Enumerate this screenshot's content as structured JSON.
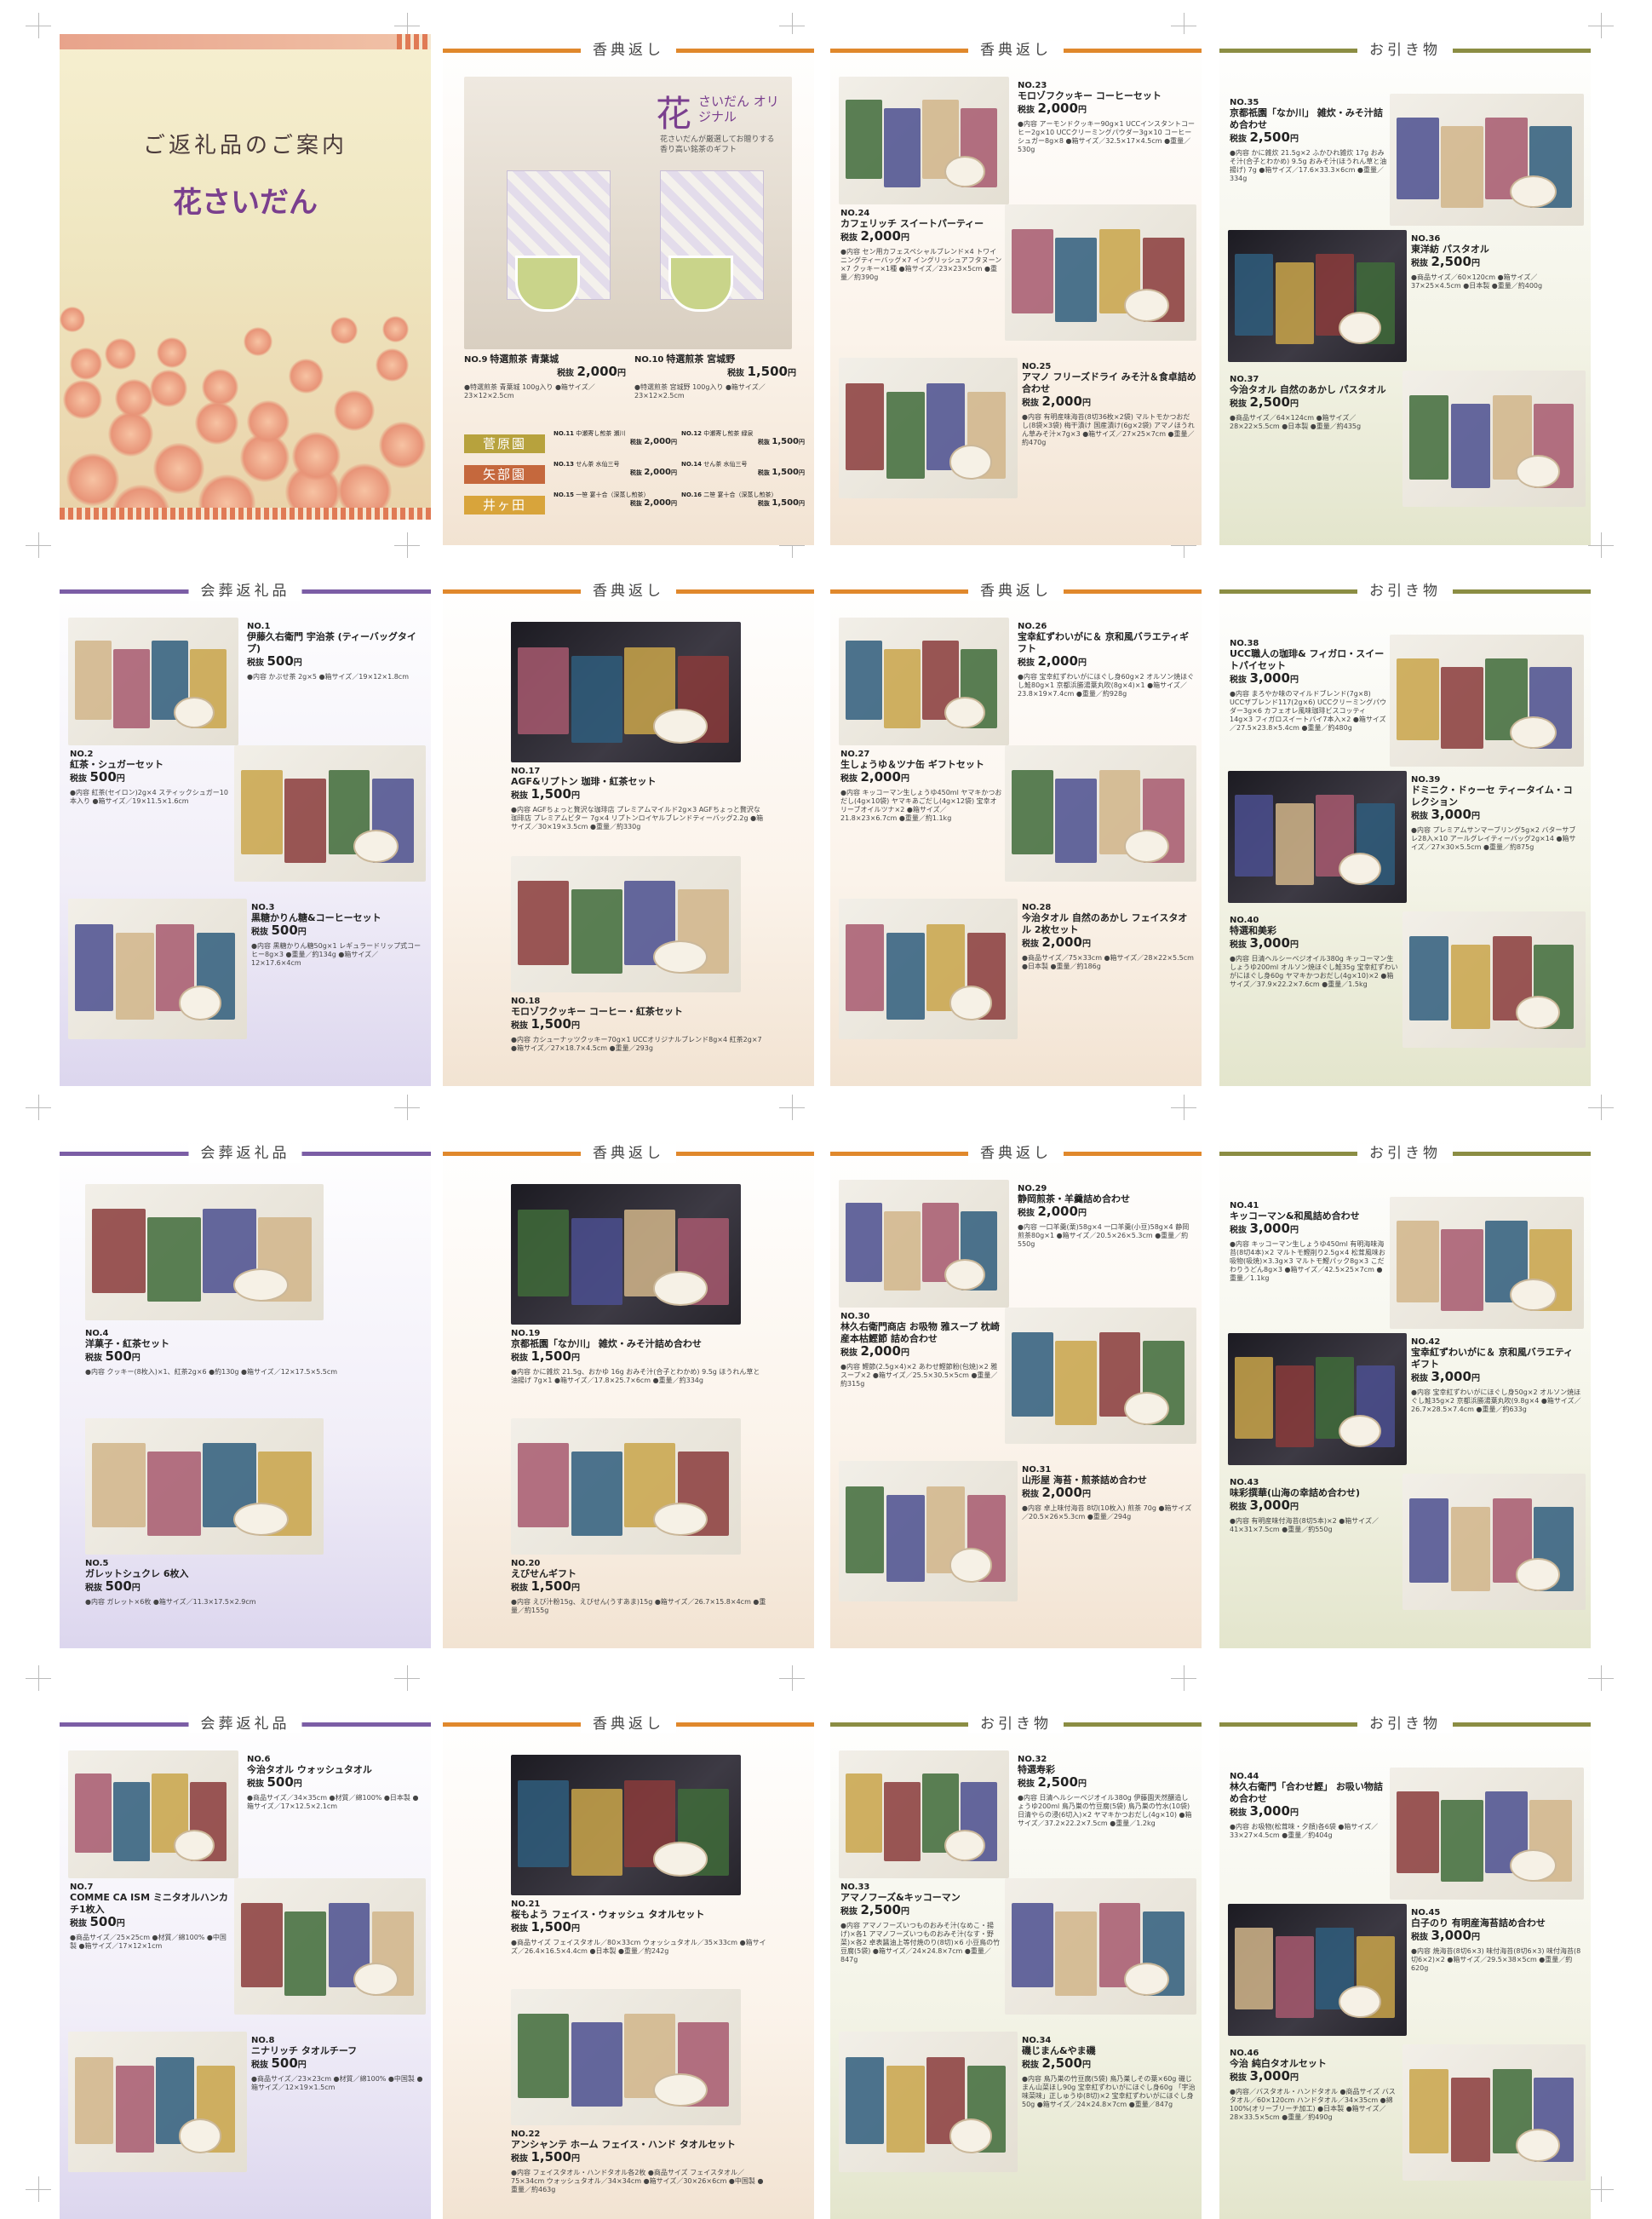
{
  "pages": [
    {
      "header": "",
      "kind": "cover",
      "title": "ご返礼品のご案内",
      "logo": "花さいだん",
      "items": []
    },
    {
      "header": "香典返し",
      "kind": "tea",
      "brand_big": "花",
      "brand_title": "さいだん オリジナル",
      "brand_sub": "花さいだんが厳選してお贈りする 香り高い銘茶のギフト",
      "items": [
        {
          "no": "NO.9",
          "name": "特選煎茶 青葉城",
          "price": "2,000",
          "desc": "●特選煎茶 青葉城 100g入り ●箱サイズ／23×12×2.5cm"
        },
        {
          "no": "NO.10",
          "name": "特選煎茶 宮城野",
          "price": "1,500",
          "desc": "●特選煎茶 宮城野 100g入り ●箱サイズ／23×12×2.5cm"
        }
      ],
      "brands": [
        "菅原園",
        "矢部園",
        "井ヶ田"
      ],
      "small": [
        {
          "no": "NO.11",
          "name": "中瀬寄し煎茶 瀬川",
          "price": "2,000"
        },
        {
          "no": "NO.12",
          "name": "中瀬寄し煎茶 緑泉",
          "price": "1,500"
        },
        {
          "no": "NO.13",
          "name": "せん茶 水仙三号",
          "price": "2,000"
        },
        {
          "no": "NO.14",
          "name": "せん茶 水仙三号",
          "price": "1,500"
        },
        {
          "no": "NO.15",
          "name": "一笹 宴十合（深蒸し煎茶）",
          "price": "2,000"
        },
        {
          "no": "NO.16",
          "name": "二笹 宴十合（深蒸し煎茶）",
          "price": "1,500"
        }
      ]
    },
    {
      "header": "香典返し",
      "items": [
        {
          "no": "NO.23",
          "name": "モロゾフクッキー コーヒーセット",
          "price": "2,000",
          "desc": "●内容 アーモンドクッキー90g×1 UCCインスタントコーヒー2g×10 UCCクリーミングパウダー3g×10 コーヒーシュガー8g×8 ●箱サイズ／32.5×17×4.5cm ●重量／530g"
        },
        {
          "no": "NO.24",
          "name": "カフェリッチ スイートパーティー",
          "price": "2,000",
          "desc": "●内容 セン用カフェスペシャルブレンド×4 トワイニングティーバッグ×7 イングリッシュアフタヌーン×7 クッキー×1種 ●箱サイズ／23×23×5cm ●重量／約390g"
        },
        {
          "no": "NO.25",
          "name": "アマノ フリーズドライ みそ汁＆食卓詰め合わせ",
          "price": "2,000",
          "desc": "●内容 有明産味海苔(8切36枚×2袋) マルトモかつおだし(8袋×3袋) 梅干漬け 国産漬け(6g×2袋) アマノほうれん草みそ汁×7g×3 ●箱サイズ／27×25×7cm ●重量／約470g"
        }
      ]
    },
    {
      "header": "お引き物",
      "items": [
        {
          "no": "NO.35",
          "name": "京都祇園「なか川」 雑炊・みそ汁詰め合わせ",
          "price": "2,500",
          "desc": "●内容 かに雑炊 21.5g×2 ふかひれ雑炊 17g おみそ汁(合子とわかめ) 9.5g おみそ汁(ほうれん草と油揚げ) 7g ●箱サイズ／17.6×33.3×6cm ●重量／334g"
        },
        {
          "no": "NO.36",
          "name": "東洋紡 パスタオル",
          "price": "2,500",
          "desc": "●商品サイズ／60×120cm ●箱サイズ／37×25×4.5cm ●日本製 ●重量／約400g"
        },
        {
          "no": "NO.37",
          "name": "今治タオル 自然のあかし パスタオル",
          "price": "2,500",
          "desc": "●商品サイズ／64×124cm ●箱サイズ／28×22×5.5cm ●日本製 ●重量／約435g"
        }
      ]
    },
    {
      "header": "会葬返礼品",
      "items": [
        {
          "no": "NO.1",
          "name": "伊藤久右衛門 宇治茶 (ティーバッグタイプ)",
          "price": "500",
          "desc": "●内容 かぶせ茶 2g×5 ●箱サイズ／19×12×1.8cm"
        },
        {
          "no": "NO.2",
          "name": "紅茶・シュガーセット",
          "price": "500",
          "desc": "●内容 紅茶(セイロン)2g×4 スティックシュガー10本入り ●箱サイズ／19×11.5×1.6cm"
        },
        {
          "no": "NO.3",
          "name": "黒糖かりん糖&コーヒーセット",
          "price": "500",
          "desc": "●内容 黒糖かりん糖50g×1 レギュラードリップ式コーヒー8g×3 ●重量／約134g ●箱サイズ／12×17.6×4cm"
        }
      ]
    },
    {
      "header": "香典返し",
      "items": [
        {
          "no": "NO.17",
          "name": "AGF&リプトン 珈琲・紅茶セット",
          "price": "1,500",
          "desc": "●内容 AGFちょっと贅沢な珈琲店 プレミアムマイルド2g×3 AGFちょっと贅沢な珈琲店 プレミアムビター 7g×4 リプトンロイヤルブレンドティーバッグ2.2g ●箱サイズ／30×19×3.5cm ●重量／約330g"
        },
        {
          "no": "NO.18",
          "name": "モロゾフクッキー コーヒー・紅茶セット",
          "price": "1,500",
          "desc": "●内容 カシューナッツクッキー70g×1 UCCオリジナルブレンド8g×4 紅茶2g×7 ●箱サイズ／27×18.7×4.5cm ●重量／293g"
        }
      ]
    },
    {
      "header": "香典返し",
      "items": [
        {
          "no": "NO.26",
          "name": "宝幸紅ずわいがに＆ 京和風バラエティギフト",
          "price": "2,000",
          "desc": "●内容 宝幸紅ずわいがにほぐし身60g×2 オルソン焼ほぐし鮭80g×1 京都浜勝湯葉丸吹(8g×4)×1 ●箱サイズ／23.8×19×7.4cm ●重量／約928g"
        },
        {
          "no": "NO.27",
          "name": "生しょうゆ＆ツナ缶 ギフトセット",
          "price": "2,000",
          "desc": "●内容 キッコーマン生しょうゆ450ml ヤマキかつおだし(4g×10袋) ヤマキあごだし(4g×12袋) 宝幸オリーブオイルツナ×2 ●箱サイズ／21.8×23×6.7cm ●重量／約1.1kg"
        },
        {
          "no": "NO.28",
          "name": "今治タオル 自然のあかし フェイスタオル 2枚セット",
          "price": "2,000",
          "desc": "●商品サイズ／75×33cm ●箱サイズ／28×22×5.5cm ●日本製 ●重量／約186g"
        }
      ]
    },
    {
      "header": "お引き物",
      "items": [
        {
          "no": "NO.38",
          "name": "UCC職人の珈琲& フィガロ・スイートパイセット",
          "price": "3,000",
          "desc": "●内容 まろやか味のマイルドブレンド(7g×8) UCCザブレンド117(2g×6) UCCクリーミングパウダー3g×6 カフェオレ風味珈琲ビスコッティ14g×3 フィガロスイートパイ7本入×2 ●箱サイズ／27.5×23.8×5.4cm ●重量／約480g"
        },
        {
          "no": "NO.39",
          "name": "ドミニク・ドゥーセ ティータイム・コレクション",
          "price": "3,000",
          "desc": "●内容 プレミアムサンマーブリング5g×2 バターサブレ28入×10 アールグレイティーバッグ2g×14 ●箱サイズ／27×30×5.5cm ●重量／約875g"
        },
        {
          "no": "NO.40",
          "name": "特選和美彩",
          "price": "3,000",
          "desc": "●内容 日清ヘルシーベジオイル380g キッコーマン生しょうゆ200ml オルソン焼ほぐし鮭35g 宝幸紅ずわいがにほぐし身60g ヤマキかつおだし(4g×10)×2 ●箱サイズ／37.9×22.2×7.6cm ●重量／1.5kg"
        }
      ]
    },
    {
      "header": "会葬返礼品",
      "items": [
        {
          "no": "NO.4",
          "name": "洋菓子・紅茶セット",
          "price": "500",
          "desc": "●内容 クッキー(8枚入)×1、紅茶2g×6 ●約130g ●箱サイズ／12×17.5×5.5cm"
        },
        {
          "no": "NO.5",
          "name": "ガレットシュクレ 6枚入",
          "price": "500",
          "desc": "●内容 ガレット×6枚 ●箱サイズ／11.3×17.5×2.9cm"
        }
      ]
    },
    {
      "header": "香典返し",
      "items": [
        {
          "no": "NO.19",
          "name": "京都祇園「なか川」 雑炊・みそ汁詰め合わせ",
          "price": "1,500",
          "desc": "●内容 かに雑炊 21.5g、おかゆ 16g おみそ汁(合子とわかめ) 9.5g ほうれん草と油揚げ 7g×1 ●箱サイズ／17.8×25.7×6cm ●重量／約334g"
        },
        {
          "no": "NO.20",
          "name": "えびせんギフト",
          "price": "1,500",
          "desc": "●内容 えび汁粉15g、えびせん(うすあま)15g ●箱サイズ／26.7×15.8×4cm ●重量／約155g"
        }
      ]
    },
    {
      "header": "香典返し",
      "items": [
        {
          "no": "NO.29",
          "name": "静岡煎茶・羊羹詰め合わせ",
          "price": "2,000",
          "desc": "●内容 一口羊羹(栗)58g×4 一口羊羹(小豆)58g×4 静岡煎茶80g×1 ●箱サイズ／20.5×26×5.3cm ●重量／約550g"
        },
        {
          "no": "NO.30",
          "name": "林久右衛門商店 お吸物 雅スープ 枕崎産本枯鰹節 詰め合わせ",
          "price": "2,000",
          "desc": "●内容 鰹節(2.5g×4)×2 あわせ鰹節粉(包焼)×2 雅スープ×2 ●箱サイズ／25.5×30.5×5cm ●重量／約315g"
        },
        {
          "no": "NO.31",
          "name": "山形屋 海苔・煎茶詰め合わせ",
          "price": "2,000",
          "desc": "●内容 卓上味付海苔 8切(10枚入) 煎茶 70g ●箱サイズ／20.5×26×5.3cm ●重量／294g"
        }
      ]
    },
    {
      "header": "お引き物",
      "items": [
        {
          "no": "NO.41",
          "name": "キッコーマン&和風詰め合わせ",
          "price": "3,000",
          "desc": "●内容 キッコーマン生しょうゆ450ml 有明海味海苔(8切4本)×2 マルトモ鰹削り2.5g×4 松茸風味お吸物(吸焼)×3.3g×3 マルトモ鰹パック8g×3 こだわりうどん8g×3 ●箱サイズ／42.5×25×7cm ●重量／1.1kg"
        },
        {
          "no": "NO.42",
          "name": "宝幸紅ずわいがに＆ 京和風バラエティギフト",
          "price": "3,000",
          "desc": "●内容 宝幸紅ずわいがにほぐし身50g×2 オルソン焼ほぐし鮭35g×2 京都浜勝湯葉丸吹(9.8g×4 ●箱サイズ／26.7×28.5×7.4cm ●重量／約633g"
        },
        {
          "no": "NO.43",
          "name": "味彩撰華(山海の幸詰め合わせ)",
          "price": "3,000",
          "desc": "●内容 有明産味付海苔(8切5本)×2 ●箱サイズ／41×31×7.5cm ●重量／約550g"
        }
      ]
    },
    {
      "header": "会葬返礼品",
      "items": [
        {
          "no": "NO.6",
          "name": "今治タオル ウォッシュタオル",
          "price": "500",
          "desc": "●商品サイズ／34×35cm ●材質／綿100% ●日本製 ●箱サイズ／17×12.5×2.1cm"
        },
        {
          "no": "NO.7",
          "name": "COMME CA ISM ミニタオルハンカチ1枚入",
          "price": "500",
          "desc": "●商品サイズ／25×25cm ●材質／綿100% ●中国製 ●箱サイズ／17×12×1cm"
        },
        {
          "no": "NO.8",
          "name": "ニナリッチ タオルチーフ",
          "price": "500",
          "desc": "●商品サイズ／23×23cm ●材質／綿100% ●中国製 ●箱サイズ／12×19×1.5cm"
        }
      ]
    },
    {
      "header": "香典返し",
      "items": [
        {
          "no": "NO.21",
          "name": "桜もよう フェイス・ウォッシュ タオルセット",
          "price": "1,500",
          "desc": "●商品サイズ フェイスタオル／80×33cm ウォッシュタオル／35×33cm ●箱サイズ／26.4×16.5×4.4cm ●日本製 ●重量／約242g"
        },
        {
          "no": "NO.22",
          "name": "アンシャンテ ホーム フェイス・ハンド タオルセット",
          "price": "1,500",
          "desc": "●内容 フェイスタオル・ハンドタオル各2枚 ●商品サイズ フェイスタオル／75×34cm ウォッシュタオル／34×34cm ●箱サイズ／30×26×6cm ●中国製 ●重量／約463g"
        }
      ]
    },
    {
      "header": "お引き物",
      "items": [
        {
          "no": "NO.32",
          "name": "特選寿彩",
          "price": "2,500",
          "desc": "●内容 日清ヘルシーベジオイル380g 伊藤園天然醸造しょうゆ200ml 鳥乃巣の竹豆腐(5袋) 鳥乃巣の竹水(10袋) 日清やらの浸(6切入)×2 ヤマキかつおだし(4g×10) ●箱サイズ／37.2×22.2×7.5cm ●重量／1.2kg"
        },
        {
          "no": "NO.33",
          "name": "アマノフーズ&キッコーマン",
          "price": "2,500",
          "desc": "●内容 アマノフーズいつものおみそ汁(なめこ・揚げ)×各1 アマノフーズいつものおみそ汁(なす・野菜)×各2 卓表醤油上等付焼のり(8切)×6 小豆鳥の竹豆腐(5袋) ●箱サイズ／24×24.8×7cm ●重量／847g"
        },
        {
          "no": "NO.34",
          "name": "磯じまん&やま磯",
          "price": "2,500",
          "desc": "●内容 鳥乃巣の竹豆腐(5袋) 鳥乃巣しその葉×60g 磯じまん山菜ほし90g 宝幸紅ずわいがにほぐし身60g 「宇治味菜味」正しゅうゆ(8切)×2 宝幸紅ずわいがにほぐし身50g ●箱サイズ／24×24.8×7cm ●重量／847g"
        }
      ]
    },
    {
      "header": "お引き物",
      "items": [
        {
          "no": "NO.44",
          "name": "林久右衛門「合わせ鰹」 お吸い物詰め合わせ",
          "price": "3,000",
          "desc": "●内容 お吸物(松茸味・夕顔)各6袋 ●箱サイズ／33×27×4.5cm ●重量／約404g"
        },
        {
          "no": "NO.45",
          "name": "白子のり 有明産海苔詰め合わせ",
          "price": "3,000",
          "desc": "●内容 焼海苔(8切6×3) 味付海苔(8切6×3) 味付海苔(8切6×2)×2 ●箱サイズ／29.5×38×5cm ●重量／約620g"
        },
        {
          "no": "NO.46",
          "name": "今治 純白タオルセット",
          "price": "3,000",
          "desc": "●内容／バスタオル・ハンドタオル ●商品サイズ バスタオル／60×120cm ハンドタオル／34×35cm ●綿100%(オリーブリーチ加工) ●日本製 ●箱サイズ／28×33.5×5cm ●重量／約490g"
        }
      ]
    }
  ],
  "price_prefix": "税抜",
  "price_suffix": "円",
  "colors": {
    "orange": "#e0882c",
    "green": "#8b8d43",
    "purple": "#7b5da5",
    "cover_logo": "#7a3f8e"
  }
}
